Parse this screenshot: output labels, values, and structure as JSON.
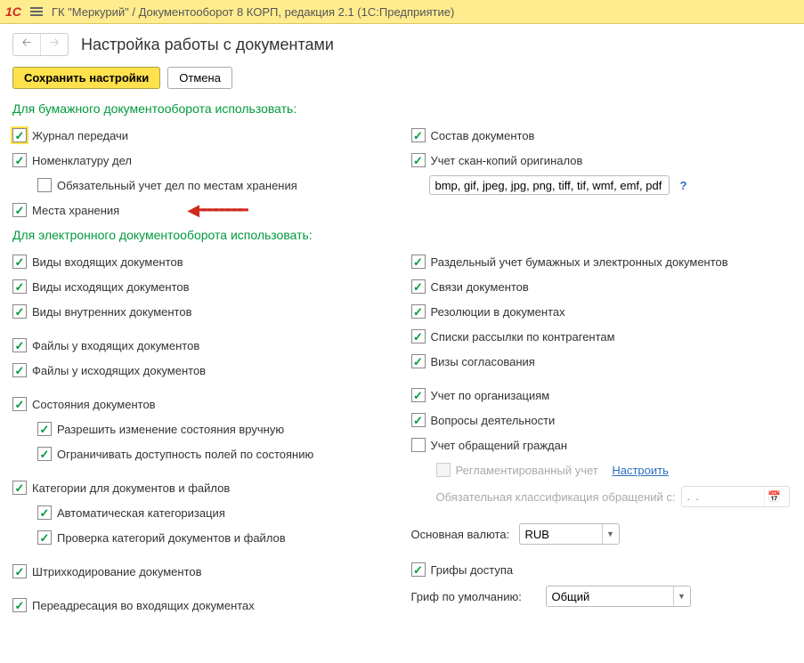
{
  "window": {
    "title": "ГК \"Меркурий\" / Документооборот 8 КОРП, редакция 2.1  (1С:Предприятие)"
  },
  "page": {
    "title": "Настройка работы с документами"
  },
  "actions": {
    "save": "Сохранить настройки",
    "cancel": "Отмена"
  },
  "sections": {
    "paper": "Для бумажного документооборота использовать:",
    "electronic": "Для электронного документооборота использовать:"
  },
  "left": {
    "journal": "Журнал передачи",
    "nomenclature": "Номенклатуру дел",
    "mandatory_storage": "Обязательный учет дел по местам хранения",
    "storage_places": "Места хранения",
    "incoming_types": "Виды входящих документов",
    "outgoing_types": "Виды исходящих документов",
    "internal_types": "Виды внутренних документов",
    "incoming_files": "Файлы у входящих документов",
    "outgoing_files": "Файлы у исходящих документов",
    "doc_states": "Состояния документов",
    "allow_manual_state": "Разрешить изменение состояния вручную",
    "restrict_fields_by_state": "Ограничивать доступность полей по состоянию",
    "categories": "Категории для документов и файлов",
    "auto_categorize": "Автоматическая категоризация",
    "check_categories": "Проверка категорий документов и файлов",
    "barcoding": "Штрихкодирование документов",
    "forward_incoming": "Переадресация во входящих документах"
  },
  "right": {
    "doc_composition": "Состав документов",
    "scan_copies": "Учет скан-копий оригиналов",
    "file_types_value": "bmp, gif, jpeg, jpg, png, tiff, tif, wmf, emf, pdf",
    "separate_paper_electronic": "Раздельный учет бумажных и электронных документов",
    "doc_links": "Связи документов",
    "resolutions": "Резолюции в документах",
    "mailing_lists": "Списки рассылки по контрагентам",
    "approval_visas": "Визы согласования",
    "by_org": "Учет по организациям",
    "activity_questions": "Вопросы деятельности",
    "citizen_appeals": "Учет обращений граждан",
    "regulated": "Регламентированный учет",
    "configure_link": "Настроить",
    "mandatory_classification": "Обязательная классификация обращений с:",
    "date_placeholder": ".  .",
    "main_currency_label": "Основная валюта:",
    "main_currency_value": "RUB",
    "access_stamps": "Грифы доступа",
    "default_stamp_label": "Гриф по умолчанию:",
    "default_stamp_value": "Общий"
  }
}
